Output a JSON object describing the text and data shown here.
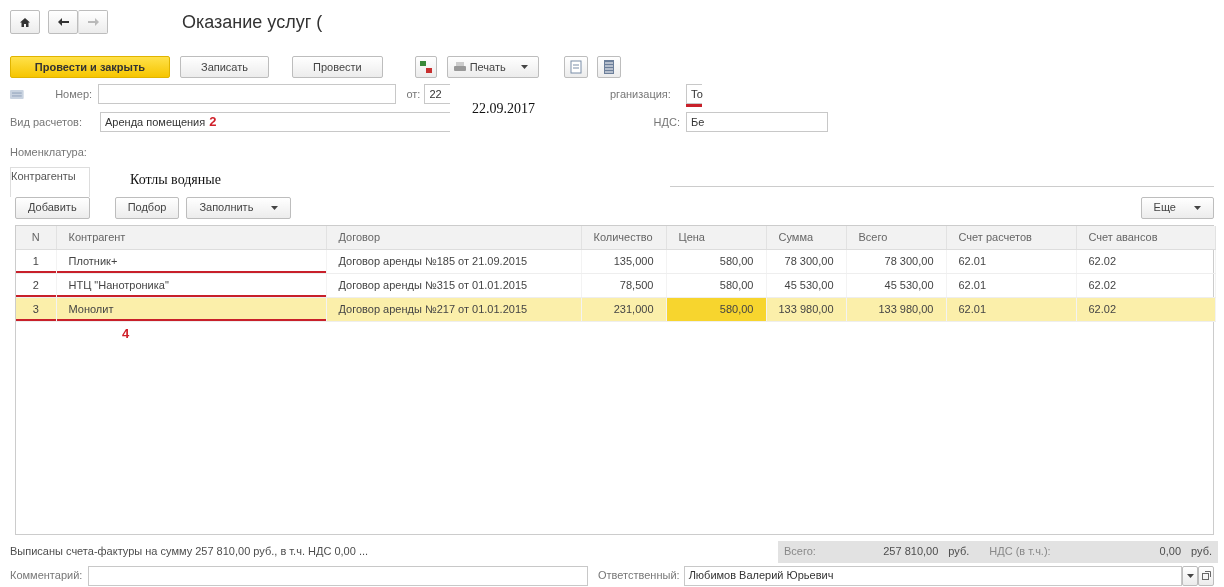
{
  "nav": [
    {
      "kind": "home",
      "disabled": false
    },
    {
      "kind": "back",
      "disabled": false
    },
    {
      "kind": "forward",
      "disabled": true
    }
  ],
  "title": "Оказание услуг (",
  "toolbar": [
    {
      "kind": "primary",
      "label": "Провести и закрыть"
    },
    {
      "kind": "button",
      "label": "Записать"
    },
    {
      "kind": "button",
      "label": "Провести"
    },
    {
      "kind": "dtkt"
    },
    {
      "kind": "print",
      "label": "Печать"
    },
    {
      "kind": "doc"
    },
    {
      "kind": "list"
    }
  ],
  "fields": {
    "number": {
      "label": "Номер:"
    },
    "date": {
      "label": "от:",
      "value": "22"
    },
    "organization": {
      "label": "рганизация:",
      "value": "То",
      "underlined": true
    },
    "settlement": {
      "label": "Вид расчетов:",
      "value": "Аренда помещения",
      "annotation": "2"
    },
    "vat": {
      "label": "НДС:",
      "value": "Бе"
    },
    "nomenclature": {
      "label": "Номенклатура:"
    }
  },
  "overlays": [
    {
      "text": "22.09.2017"
    },
    {
      "text": "Котлы водяные"
    }
  ],
  "tabs": [
    {
      "label": "Контрагенты",
      "selected": true
    }
  ],
  "table_toolbar": [
    {
      "kind": "button",
      "label": "Добавить"
    },
    {
      "kind": "button",
      "label": "Подбор"
    },
    {
      "kind": "dropdown",
      "label": "Заполнить"
    }
  ],
  "more_button": "Еще",
  "table": {
    "columns": [
      "N",
      "Контрагент",
      "Договор",
      "Количество",
      "Цена",
      "Сумма",
      "Всего",
      "Счет расчетов",
      "Счет авансов"
    ],
    "rows": [
      {
        "cells": [
          "1",
          "Плотник+",
          "Договор аренды №185 от 21.09.2015",
          "135,000",
          "580,00",
          "78 300,00",
          "78 300,00",
          "62.01",
          "62.02"
        ],
        "selected": false,
        "underlined": true
      },
      {
        "cells": [
          "2",
          "НТЦ \"Нанотроника\"",
          "Договор аренды №315 от 01.01.2015",
          "78,500",
          "580,00",
          "45 530,00",
          "45 530,00",
          "62.01",
          "62.02"
        ],
        "selected": false,
        "underlined": true
      },
      {
        "cells": [
          "3",
          "Монолит",
          "Договор аренды №217 от 01.01.2015",
          "231,000",
          "580,00",
          "133 980,00",
          "133 980,00",
          "62.01",
          "62.02"
        ],
        "selected": true,
        "underlined": true
      }
    ],
    "annotation": "4"
  },
  "summary": {
    "note": "Выписаны счета-фактуры на сумму 257 810,00 руб., в т.ч. НДС 0,00 ...",
    "total_label": "Всего:",
    "total": "257 810,00",
    "total_currency": "руб.",
    "vat_label": "НДС (в т.ч.):",
    "vat": "0,00",
    "vat_currency": "руб."
  },
  "comment": {
    "label": "Комментарий:"
  },
  "responsible": {
    "label": "Ответственный:",
    "value": "Любимов Валерий Юрьевич"
  }
}
